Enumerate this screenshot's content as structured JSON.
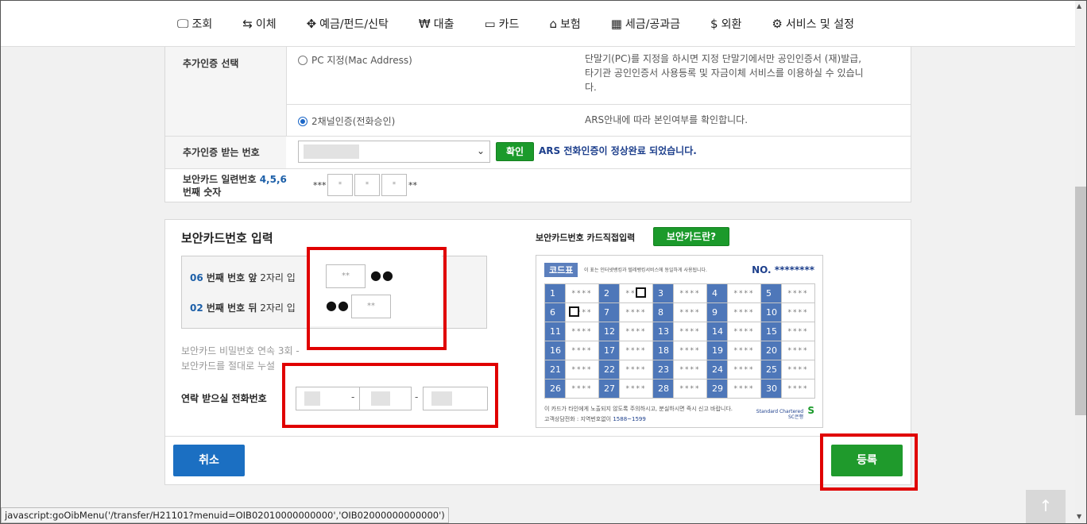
{
  "nav": [
    {
      "icon": "🖵",
      "label": "조회"
    },
    {
      "icon": "⇆",
      "label": "이체"
    },
    {
      "icon": "✥",
      "label": "예금/펀드/신탁"
    },
    {
      "icon": "₩",
      "label": "대출"
    },
    {
      "icon": "▭",
      "label": "카드"
    },
    {
      "icon": "⌂",
      "label": "보험"
    },
    {
      "icon": "▦",
      "label": "세금/공과금"
    },
    {
      "icon": "$",
      "label": "외환"
    },
    {
      "icon": "⚙",
      "label": "서비스 및 설정"
    }
  ],
  "auth": {
    "method_label": "추가인증 선택",
    "option_pc": "PC 지정(Mac Address)",
    "option_pc_desc": [
      "단말기(PC)를 지정을 하시면 지정 단말기에서만 공인인증서 (재)발급,",
      "타기관 공인인증서 사용등록 및 자금이체 서비스를 이용하실 수 있습니",
      "다."
    ],
    "option_phone": "2채널인증(전화승인)",
    "option_phone_desc": "ARS안내에 따라 본인여부를 확인합니다.",
    "number_label": "추가인증 받는 번호",
    "confirm_button": "확인",
    "confirm_message": "ARS 전화인증이 정상완료 되었습니다.",
    "serial_label_prefix": "보안카드 일련번호 ",
    "serial_label_digits": "4,5,6",
    "serial_label_suffix": "번째 숫자",
    "serial_prefix": "***",
    "serial_suffix": "**",
    "mini_placeholder": "*"
  },
  "secure": {
    "title": "보안카드번호 입력",
    "row1_num": "06",
    "row1_text": " 번째 번호 앞",
    "row1_rest": " 2자리 입",
    "row2_num": "02",
    "row2_text": " 번째 번호 뒤",
    "row2_rest": " 2자리 입",
    "pin_placeholder": "**",
    "dots": "●●",
    "notice1": "보안카드 비밀번호 연속 3회 -",
    "notice2": "보안카드를 절대로 누설",
    "phone_label": "연락 받으실 전화번호",
    "dash": "-",
    "card_direct_label": "보안카드번호 카드직접입력",
    "card_info_button": "보안카드란?",
    "cancel": "취소",
    "register": "등록"
  },
  "card": {
    "tag": "코드표",
    "desc": "이 표는 인터넷뱅킹과 텔레뱅킹서비스에 동일하게 사용됩니다.",
    "no": "NO. ********",
    "cell_mask": "****",
    "rows": [
      [
        1,
        2,
        3,
        4,
        5
      ],
      [
        6,
        7,
        8,
        9,
        10
      ],
      [
        11,
        12,
        13,
        14,
        15
      ],
      [
        16,
        17,
        18,
        19,
        20
      ],
      [
        21,
        22,
        23,
        24,
        25
      ],
      [
        26,
        27,
        28,
        29,
        30
      ]
    ],
    "foot1": "이 카드가 타인에게 노출되지 않도록 주의하시고, 분실하시면 즉시 신고 바랍니다.",
    "foot2_prefix": "고객상담전화 : 지역번호없이 ",
    "foot2_phone": "1588~1599",
    "brand1": "Standard Chartered",
    "brand2": "SC은행",
    "brand_mark": "S"
  },
  "status_bar": "javascript:goOibMenu('/transfer/H21101?menuid=OIB02010000000000','OIB02000000000000')",
  "to_top": "↑",
  "colors": {
    "accent_green": "#1b9a2b",
    "accent_blue": "#1b6fc2",
    "highlight_red": "#e00000",
    "card_blue": "#4e77b9"
  }
}
